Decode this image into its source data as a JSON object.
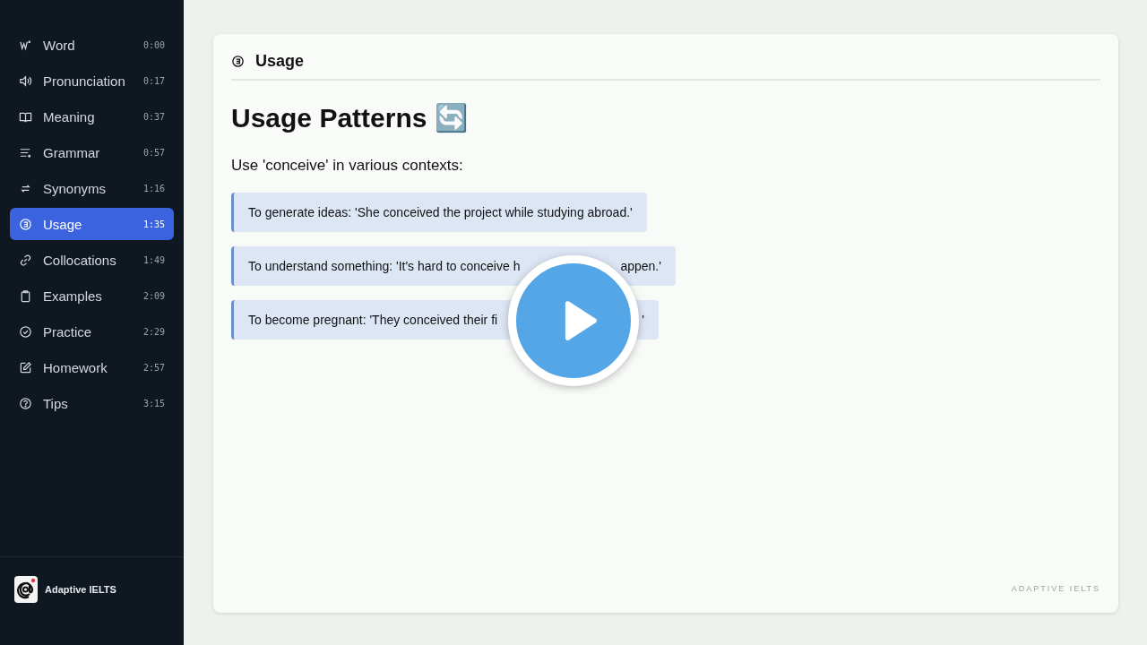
{
  "sidebar": {
    "items": [
      {
        "label": "Word",
        "time": "0:00",
        "selected": false
      },
      {
        "label": "Pronunciation",
        "time": "0:17",
        "selected": false
      },
      {
        "label": "Meaning",
        "time": "0:37",
        "selected": false
      },
      {
        "label": "Grammar",
        "time": "0:57",
        "selected": false
      },
      {
        "label": "Synonyms",
        "time": "1:16",
        "selected": false
      },
      {
        "label": "Usage",
        "time": "1:35",
        "selected": true
      },
      {
        "label": "Collocations",
        "time": "1:49",
        "selected": false
      },
      {
        "label": "Examples",
        "time": "2:09",
        "selected": false
      },
      {
        "label": "Practice",
        "time": "2:29",
        "selected": false
      },
      {
        "label": "Homework",
        "time": "2:57",
        "selected": false
      },
      {
        "label": "Tips",
        "time": "3:15",
        "selected": false
      }
    ],
    "brand": "Adaptive IELTS"
  },
  "card": {
    "section": "Usage",
    "heading": "Usage Patterns 🔄",
    "intro": "Use 'conceive' in various contexts:",
    "patterns": [
      {
        "parts": [
          "To generate ideas: 'She conceived the project while studying abroad.'"
        ]
      },
      {
        "parts": [
          "To understand something: 'It's hard to conceive h",
          "appen.'"
        ]
      },
      {
        "parts": [
          "To become pregnant: 'They conceived their fi",
          "'"
        ]
      }
    ],
    "watermark": "ADAPTIVE IELTS"
  }
}
